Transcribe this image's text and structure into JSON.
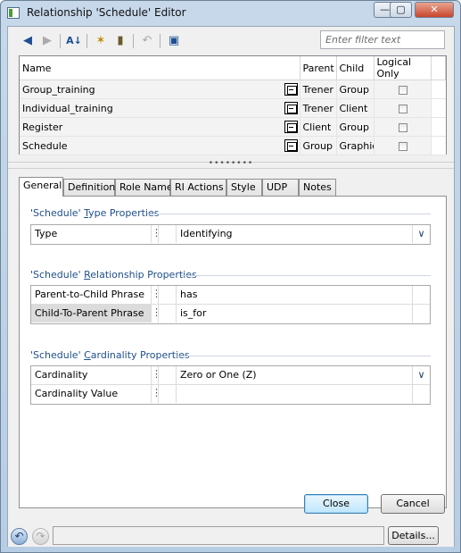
{
  "window": {
    "title": "Relationship 'Schedule' Editor",
    "buttons": [
      "—",
      "▢",
      "✕"
    ]
  },
  "toolbar": {
    "icons": [
      "first-icon",
      "next-icon",
      "sort-icon",
      "new-icon",
      "delete-icon",
      "undo-icon",
      "notebook-icon"
    ],
    "filter_placeholder": "Enter filter text"
  },
  "grid": {
    "columns": [
      "Name",
      "Parent",
      "Child",
      "Logical Only"
    ],
    "rows": [
      {
        "name": "Group_training",
        "parent": "Trener",
        "child": "Group"
      },
      {
        "name": "Individual_training",
        "parent": "Trener",
        "child": "Client"
      },
      {
        "name": "Register",
        "parent": "Client",
        "child": "Group"
      },
      {
        "name": "Schedule",
        "parent": "Group",
        "child": "Graphic"
      }
    ]
  },
  "splitter": "••••••••",
  "tabs": [
    "General",
    "Definition",
    "Role Name",
    "RI Actions",
    "Style",
    "UDP",
    "Notes"
  ],
  "sections": {
    "type": {
      "prefix": "'Schedule' ",
      "underlined": "T",
      "rest": "ype Properties"
    },
    "relationship": {
      "prefix": "'Schedule' ",
      "underlined": "R",
      "rest": "elationship Properties"
    },
    "cardinality": {
      "prefix": "'Schedule' ",
      "underlined": "C",
      "rest": "ardinality Properties"
    }
  },
  "props": {
    "type": {
      "label": "Type",
      "value": "Identifying",
      "dropdown": "∨"
    },
    "p2c": {
      "label": "Parent-to-Child Phrase",
      "value": "has"
    },
    "c2p": {
      "label": "Child-To-Parent Phrase",
      "value": "is_for"
    },
    "cardinality": {
      "label": "Cardinality",
      "value": "Zero or One (Z)",
      "dropdown": "∨"
    },
    "cardinality_value": {
      "label": "Cardinality Value",
      "value": ""
    }
  },
  "buttons": {
    "close": "Close",
    "cancel": "Cancel",
    "details": "Details..."
  }
}
